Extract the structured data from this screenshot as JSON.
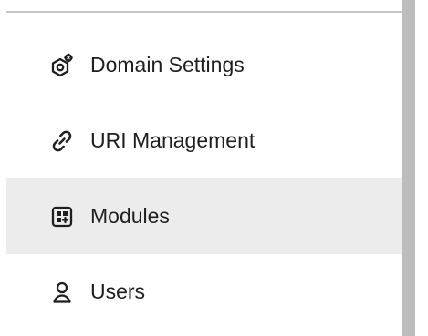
{
  "sidebar": {
    "items": [
      {
        "icon": "domain-settings-icon",
        "label": "Domain Settings",
        "active": false
      },
      {
        "icon": "link-icon",
        "label": "URI Management",
        "active": false
      },
      {
        "icon": "modules-icon",
        "label": "Modules",
        "active": true
      },
      {
        "icon": "user-icon",
        "label": "Users",
        "active": false
      }
    ],
    "active_background": "#ececec",
    "text_color": "#1f1f1f",
    "icon_color": "#1f1f1f"
  }
}
